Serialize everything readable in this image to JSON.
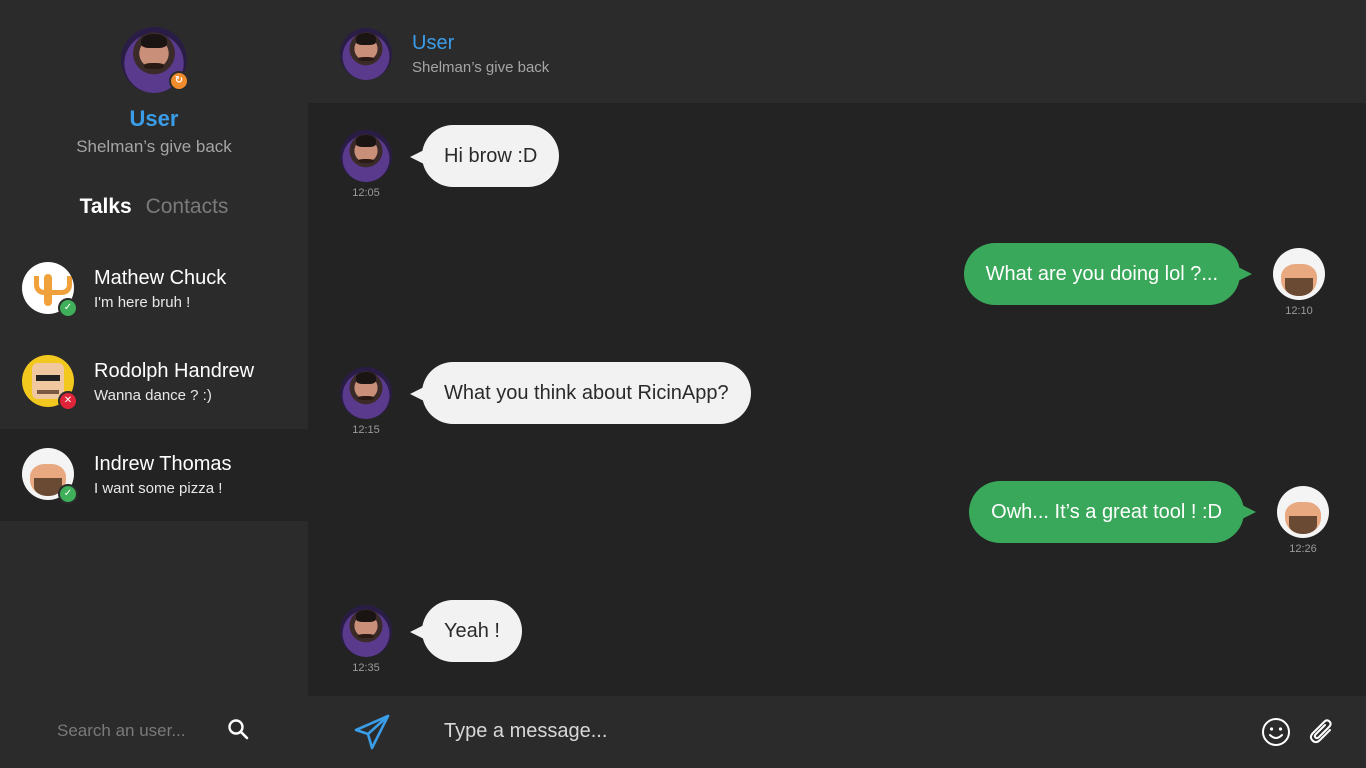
{
  "profile": {
    "name": "User",
    "status": "Shelman’s give back",
    "badge_icon": "refresh-icon",
    "badge_color": "#f08c2e"
  },
  "tabs": [
    {
      "label": "Talks",
      "active": true
    },
    {
      "label": "Contacts",
      "active": false
    }
  ],
  "talks": [
    {
      "name": "Mathew Chuck",
      "preview": "I'm here bruh !",
      "status": "online",
      "status_icon": "check-icon"
    },
    {
      "name": "Rodolph Handrew",
      "preview": "Wanna dance ? :)",
      "status": "busy",
      "status_icon": "x-icon"
    },
    {
      "name": "Indrew Thomas",
      "preview": "I want some pizza !",
      "status": "online",
      "status_icon": "check-icon",
      "selected": true
    }
  ],
  "search": {
    "placeholder": "Search an user..."
  },
  "chat_header": {
    "name": "User",
    "status": "Shelman’s give back"
  },
  "messages": [
    {
      "direction": "in",
      "text": "Hi brow :D",
      "time": "12:05"
    },
    {
      "direction": "out",
      "text": "What are you doing lol ?...",
      "time": "12:10"
    },
    {
      "direction": "in",
      "text": "What you think about RicinApp?",
      "time": "12:15"
    },
    {
      "direction": "out",
      "text": "Owh... It’s a great tool ! :D",
      "time": "12:26"
    },
    {
      "direction": "in",
      "text": "Yeah !",
      "time": "12:35"
    }
  ],
  "composer": {
    "placeholder": "Type a message..."
  },
  "colors": {
    "accent": "#3a9de8",
    "outgoing_bubble": "#3aa85a",
    "incoming_bubble": "#f2f2f2",
    "online": "#3faf5a",
    "busy": "#e0253b"
  }
}
